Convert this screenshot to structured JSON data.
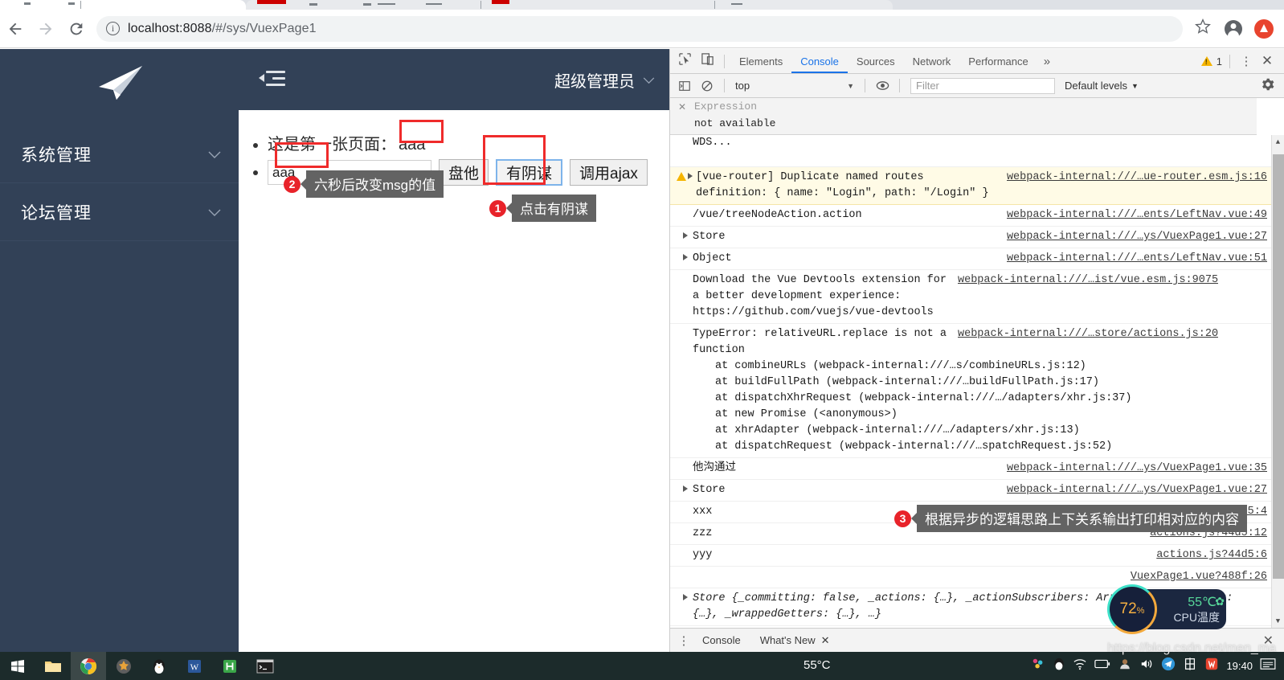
{
  "browser": {
    "back_icon": "back-arrow-icon",
    "forward_icon": "forward-arrow-icon",
    "reload_icon": "reload-icon",
    "site_info_icon": "info-circle-icon",
    "url_host": "localhost:8088",
    "url_rest": "/#/sys/VuexPage1",
    "url_full": "localhost:8088/#/sys/VuexPage1",
    "bookmark_icon": "star-icon",
    "profile_icon": "account-avatar-icon",
    "extension_icon": "extension-icon"
  },
  "app": {
    "logo": "paper-plane-logo",
    "sidebar": {
      "items": [
        {
          "label": "系统管理",
          "icon": "chevron-down-icon"
        },
        {
          "label": "论坛管理",
          "icon": "chevron-down-icon"
        }
      ]
    },
    "header": {
      "collapse_icon": "menu-collapse-icon",
      "user": "超级管理员",
      "user_caret": "chevron-down-icon"
    },
    "content": {
      "line1_label": "这是第一张页面：",
      "line1_value": "aaa",
      "input_value": "aaa",
      "buttons": [
        {
          "label": "盘他",
          "focused": false
        },
        {
          "label": "有阴谋",
          "focused": true
        },
        {
          "label": "调用ajax",
          "focused": false
        }
      ]
    },
    "annotations": [
      {
        "num": "1",
        "text": "点击有阴谋"
      },
      {
        "num": "2",
        "text": "六秒后改变msg的值"
      },
      {
        "num": "3",
        "text": "根据异步的逻辑思路上下关系输出打印相对应的内容"
      }
    ]
  },
  "devtools": {
    "inspect_icon": "inspect-cursor-icon",
    "device_icon": "device-toggle-icon",
    "tabs": [
      {
        "label": "Elements",
        "active": false
      },
      {
        "label": "Console",
        "active": true
      },
      {
        "label": "Sources",
        "active": false
      },
      {
        "label": "Network",
        "active": false
      },
      {
        "label": "Performance",
        "active": false
      }
    ],
    "more_tabs_icon": "chevron-double-right-icon",
    "warning_count": "1",
    "warning_icon": "warning-triangle-icon",
    "kebab_icon": "more-vertical-icon",
    "close_icon": "close-icon",
    "subbar": {
      "sidebar_toggle_icon": "console-sidebar-icon",
      "clear_icon": "clear-console-icon",
      "context": "top",
      "context_caret": "chevron-down-icon",
      "eye_icon": "live-expression-icon",
      "filter_placeholder": "Filter",
      "filter_value": "",
      "levels": "Default levels",
      "levels_caret": "chevron-down-icon",
      "settings_icon": "gear-icon"
    },
    "expression_panel": {
      "close_icon": "close-icon",
      "label": "Expression",
      "value": "not available"
    },
    "logs": [
      {
        "kind": "plain-cut",
        "message": "WDS...",
        "source": "",
        "cut": true
      },
      {
        "kind": "warning",
        "message": "[vue-router] Duplicate named routes definition: { name: \"Login\", path: \"/Login\" }",
        "source": "webpack-internal:///…ue-router.esm.js:16",
        "expandable": true
      },
      {
        "kind": "log",
        "message": "/vue/treeNodeAction.action",
        "source": "webpack-internal:///…ents/LeftNav.vue:49"
      },
      {
        "kind": "object",
        "message": "Store",
        "source": "webpack-internal:///…ys/VuexPage1.vue:27",
        "expandable": true
      },
      {
        "kind": "object",
        "message": "Object",
        "source": "webpack-internal:///…ents/LeftNav.vue:51",
        "expandable": true
      },
      {
        "kind": "log",
        "message": "Download the Vue Devtools extension for a better development experience:\nhttps://github.com/vuejs/vue-devtools",
        "source": "webpack-internal:///…ist/vue.esm.js:9075"
      },
      {
        "kind": "error-stack",
        "message": "TypeError: relativeURL.replace is not a function",
        "source": "webpack-internal:///…store/actions.js:20",
        "stack": [
          "at combineURLs (webpack-internal:///…s/combineURLs.js:12)",
          "at buildFullPath (webpack-internal:///…buildFullPath.js:17)",
          "at dispatchXhrRequest (webpack-internal:///…/adapters/xhr.js:37)",
          "at new Promise (<anonymous>)",
          "at xhrAdapter (webpack-internal:///…/adapters/xhr.js:13)",
          "at dispatchRequest (webpack-internal:///…spatchRequest.js:52)"
        ]
      },
      {
        "kind": "log",
        "message": "他沟通过",
        "source": "webpack-internal:///…ys/VuexPage1.vue:35"
      },
      {
        "kind": "object",
        "message": "Store",
        "source": "webpack-internal:///…ys/VuexPage1.vue:27",
        "expandable": true
      },
      {
        "kind": "log",
        "message": "xxx",
        "source": "actions.js?44d5:4"
      },
      {
        "kind": "log",
        "message": "zzz",
        "source": "actions.js?44d5:12"
      },
      {
        "kind": "log",
        "message": "yyy",
        "source": "actions.js?44d5:6"
      },
      {
        "kind": "blank",
        "message": "",
        "source": "VuexPage1.vue?488f:26"
      },
      {
        "kind": "object-detail",
        "message": "Store {_committing: false, _actions: {…}, _actionSubscribers: Array(0), _mutations: {…}, _wrappedGetters: {…}, …}",
        "source": "",
        "expandable": true
      }
    ],
    "prompt_icon": "prompt-chevron-icon",
    "drawer": {
      "kebab_icon": "more-vertical-icon",
      "tabs": [
        {
          "label": "Console",
          "closable": false
        },
        {
          "label": "What's New",
          "closable": true
        }
      ],
      "close_icon": "close-icon"
    },
    "scrollbar": {
      "up_icon": "scroll-up-arrow-icon",
      "down_icon": "scroll-down-arrow-icon"
    }
  },
  "cpu_widget": {
    "usage": "72",
    "usage_unit": "%",
    "temperature": "55℃",
    "label": "CPU温度",
    "leaf_icon": "leaf-icon"
  },
  "taskbar": {
    "temperature": "55°C",
    "clock": "19:40",
    "icons": [
      "windows-start-icon",
      "file-explorer-icon",
      "chrome-icon",
      "javaee-icon",
      "qq-penguin-icon",
      "word-icon",
      "huawei-icon",
      "terminal-icon"
    ],
    "tray_icons": [
      "screenshot-icon",
      "qq-tray-icon",
      "wifi-icon",
      "battery-icon",
      "tray-user-icon",
      "volume-icon",
      "telegram-icon",
      "ime-chinese-icon",
      "wps-icon"
    ],
    "notification_icon": "notification-center-icon"
  },
  "watermark": "https://blog.csdn.net/men_ma",
  "colors": {
    "sidebar_bg": "#324157",
    "accent_blue": "#1a73e8",
    "annotation_red": "#ef2b2b",
    "warning_yellow": "#f5b400"
  }
}
